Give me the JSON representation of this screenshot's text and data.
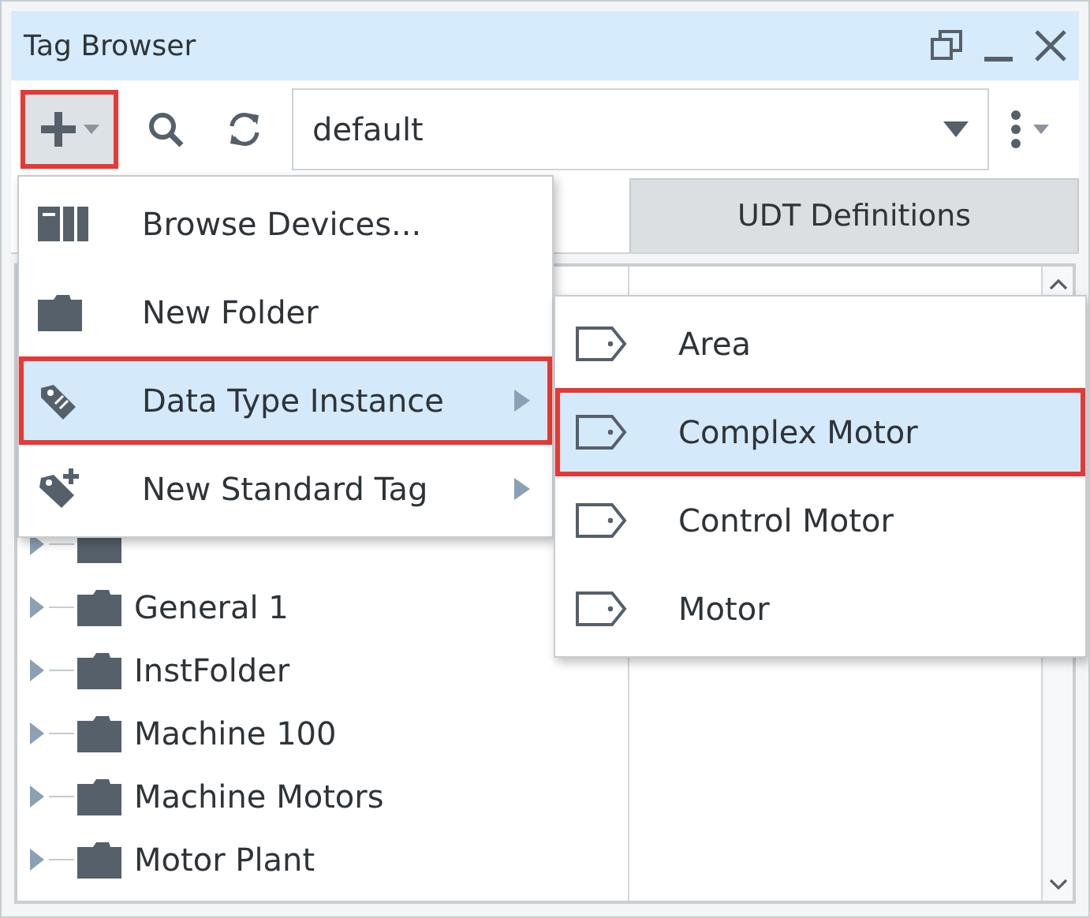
{
  "window": {
    "title": "Tag Browser"
  },
  "toolbar": {
    "provider": {
      "value": "default"
    }
  },
  "tabs": [
    {
      "label": "UDT Definitions",
      "selected": false
    }
  ],
  "tree": {
    "items": [
      {
        "expanded": false
      },
      {
        "label": "General 1",
        "expanded": false
      },
      {
        "label": "InstFolder",
        "expanded": false
      },
      {
        "label": "Machine 100",
        "expanded": false
      },
      {
        "label": "Machine Motors",
        "expanded": false
      },
      {
        "label": "Motor Plant",
        "expanded": false
      }
    ]
  },
  "menu": {
    "items": [
      {
        "label": "Browse Devices...",
        "kind": "devices",
        "submenu": false,
        "selected": false
      },
      {
        "label": "New Folder",
        "kind": "folder",
        "submenu": false,
        "selected": false
      },
      {
        "label": "Data Type Instance",
        "kind": "instance",
        "submenu": true,
        "selected": true
      },
      {
        "label": "New Standard Tag",
        "kind": "tag",
        "submenu": true,
        "selected": false
      }
    ]
  },
  "submenu": {
    "items": [
      {
        "label": "Area",
        "selected": false
      },
      {
        "label": "Complex Motor",
        "selected": true
      },
      {
        "label": "Control Motor",
        "selected": false
      },
      {
        "label": "Motor",
        "selected": false
      }
    ]
  }
}
